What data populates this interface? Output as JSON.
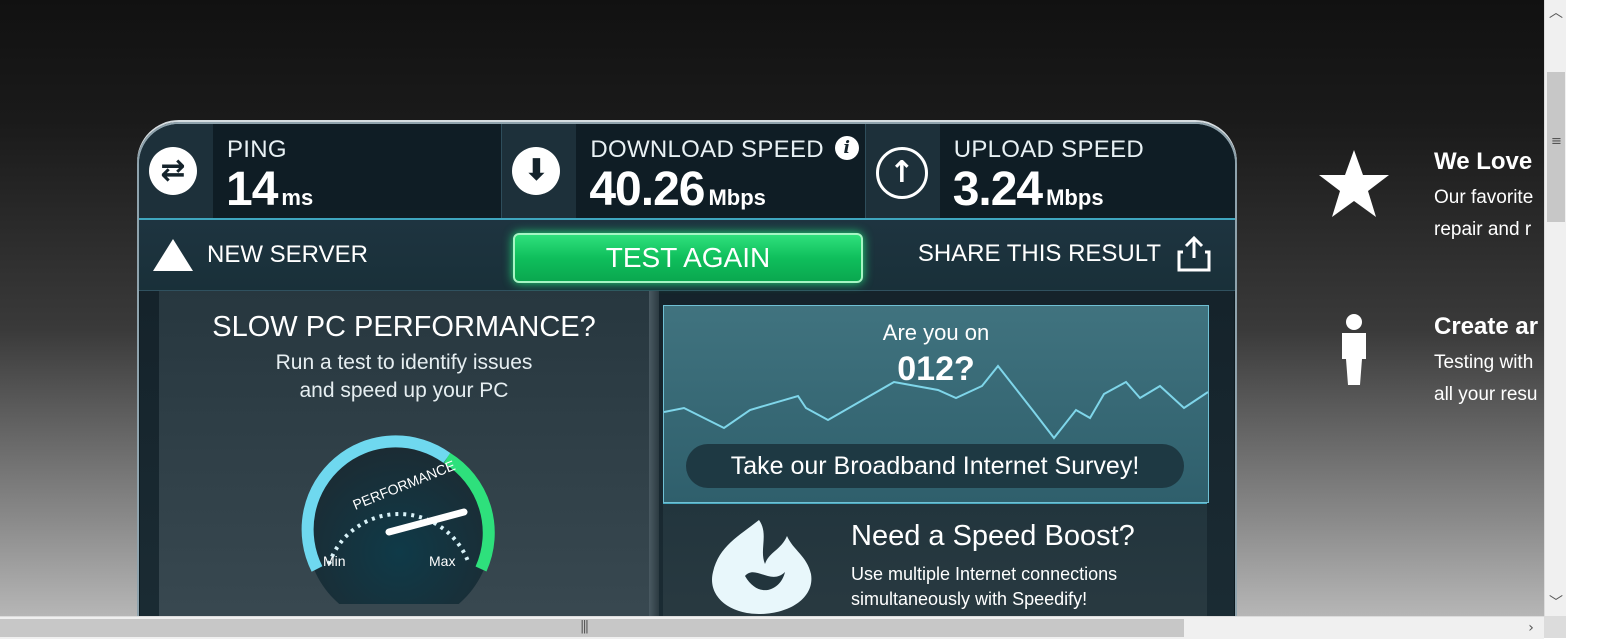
{
  "metrics": {
    "ping": {
      "label": "PING",
      "value": "14",
      "unit": "ms",
      "icon": "ping-arrows-icon"
    },
    "download": {
      "label": "DOWNLOAD SPEED",
      "value": "40.26",
      "unit": "Mbps",
      "icon": "download-arrow-icon",
      "info_icon": "i"
    },
    "upload": {
      "label": "UPLOAD SPEED",
      "value": "3.24",
      "unit": "Mbps",
      "icon": "upload-arrow-icon"
    }
  },
  "actions": {
    "new_server": "NEW SERVER",
    "test_again": "TEST AGAIN",
    "share": "SHARE THIS RESULT"
  },
  "slow_pc": {
    "title": "SLOW PC PERFORMANCE?",
    "subtitle_line1": "Run a test to identify issues",
    "subtitle_line2": "and speed up your PC",
    "gauge_label": "PERFORMANCE",
    "gauge_min": "Min",
    "gauge_max": "Max"
  },
  "survey": {
    "question": "Are you on",
    "number": "012?",
    "button": "Take our Broadband Internet Survey!"
  },
  "boost": {
    "title": "Need a Speed Boost?",
    "text_line1": "Use multiple Internet connections",
    "text_line2": "simultaneously with Speedify!"
  },
  "promo": [
    {
      "icon": "star-icon",
      "title": "We Love",
      "text_line1": "Our favorite",
      "text_line2": "repair and r"
    },
    {
      "icon": "person-icon",
      "title": "Create ar",
      "text_line1": "Testing with",
      "text_line2": "all your resu"
    }
  ],
  "colors": {
    "accent_green": "#0fbf5c",
    "accent_cyan": "#3fa6bf",
    "panel_dark": "#0f1d25"
  }
}
